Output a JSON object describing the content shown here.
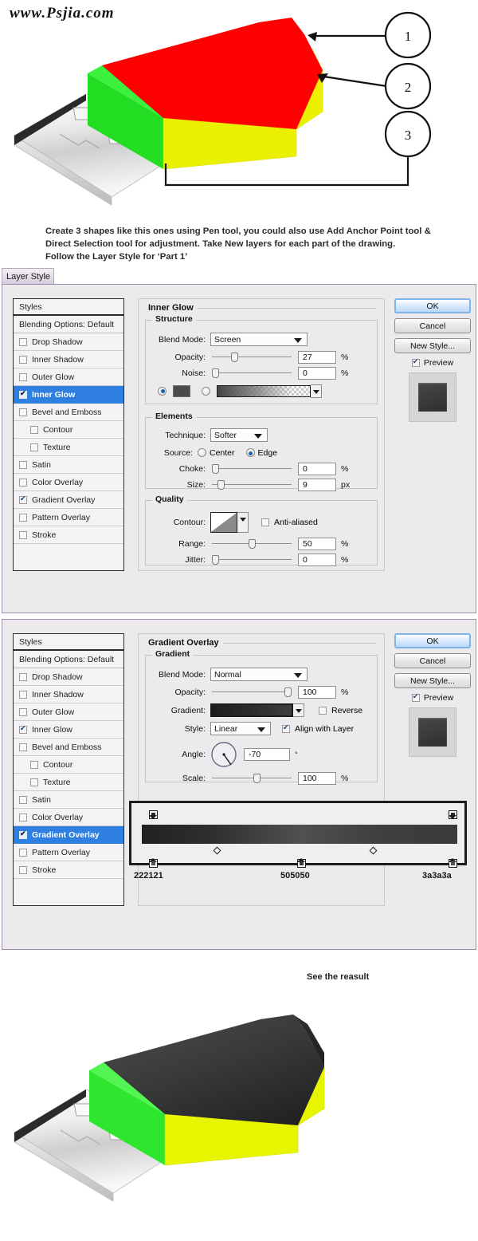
{
  "watermark": "www.Psjia.com",
  "figure_callout": {
    "name": "usb-flash-drive-wireframe",
    "callouts": [
      {
        "number": "1",
        "target": "top-face-red"
      },
      {
        "number": "2",
        "target": "side-face-yellow"
      },
      {
        "number": "3",
        "target": "edge-face-green"
      }
    ],
    "colors": {
      "part1_top": "#ff0000",
      "part2_side": "#eaf000",
      "part3_edge": "#22dd22",
      "connector_metal": "#d8d8d8"
    }
  },
  "instructions": {
    "line1": "Create 3 shapes like this ones using Pen tool, you could also use Add Anchor Point tool &",
    "line2": "Direct Selection tool for adjustment. Take New layers for each part of the drawing.",
    "line3": "Follow the Layer Style for ‘Part 1’"
  },
  "window": {
    "title": "Layer Style"
  },
  "styles_list": {
    "header": "Styles",
    "blending_options": "Blending Options: Default",
    "items": [
      {
        "label": "Drop Shadow",
        "checked": false,
        "sub": false
      },
      {
        "label": "Inner Shadow",
        "checked": false,
        "sub": false
      },
      {
        "label": "Outer Glow",
        "checked": false,
        "sub": false
      },
      {
        "label": "Inner Glow",
        "checked": true,
        "sub": false
      },
      {
        "label": "Bevel and Emboss",
        "checked": false,
        "sub": false
      },
      {
        "label": "Contour",
        "checked": false,
        "sub": true
      },
      {
        "label": "Texture",
        "checked": false,
        "sub": true
      },
      {
        "label": "Satin",
        "checked": false,
        "sub": false
      },
      {
        "label": "Color Overlay",
        "checked": false,
        "sub": false
      },
      {
        "label": "Gradient Overlay",
        "checked": true,
        "sub": false
      },
      {
        "label": "Pattern Overlay",
        "checked": false,
        "sub": false
      },
      {
        "label": "Stroke",
        "checked": false,
        "sub": false
      }
    ]
  },
  "actions": {
    "ok": "OK",
    "cancel": "Cancel",
    "new_style": "New Style...",
    "preview": "Preview",
    "preview_checked": true,
    "accent": "#7fb4e8"
  },
  "dialog_inner_glow": {
    "selected_style": "Inner Glow",
    "panel_title": "Inner Glow",
    "structure": {
      "group_title": "Structure",
      "blend_mode_label": "Blend Mode:",
      "blend_mode_value": "Screen",
      "opacity_label": "Opacity:",
      "opacity_value": "27",
      "opacity_unit": "%",
      "noise_label": "Noise:",
      "noise_value": "0",
      "noise_unit": "%",
      "fill_type": "color",
      "color_swatch": "#4a4a4a"
    },
    "elements": {
      "group_title": "Elements",
      "technique_label": "Technique:",
      "technique_value": "Softer",
      "source_label": "Source:",
      "source_center": "Center",
      "source_edge": "Edge",
      "source_selected": "Edge",
      "choke_label": "Choke:",
      "choke_value": "0",
      "choke_unit": "%",
      "size_label": "Size:",
      "size_value": "9",
      "size_unit": "px"
    },
    "quality": {
      "group_title": "Quality",
      "contour_label": "Contour:",
      "anti_aliased_label": "Anti-aliased",
      "anti_aliased_checked": false,
      "range_label": "Range:",
      "range_value": "50",
      "range_unit": "%",
      "jitter_label": "Jitter:",
      "jitter_value": "0",
      "jitter_unit": "%"
    }
  },
  "dialog_gradient_overlay": {
    "selected_style": "Gradient Overlay",
    "panel_title": "Gradient Overlay",
    "gradient": {
      "group_title": "Gradient",
      "blend_mode_label": "Blend Mode:",
      "blend_mode_value": "Normal",
      "opacity_label": "Opacity:",
      "opacity_value": "100",
      "opacity_unit": "%",
      "gradient_label": "Gradient:",
      "reverse_label": "Reverse",
      "reverse_checked": false,
      "style_label": "Style:",
      "style_value": "Linear",
      "align_with_layer_label": "Align with Layer",
      "align_with_layer_checked": true,
      "angle_label": "Angle:",
      "angle_value": "-70",
      "angle_unit": "°",
      "scale_label": "Scale:",
      "scale_value": "100",
      "scale_unit": "%"
    },
    "gradient_editor": {
      "stops": [
        {
          "hex": "222121",
          "position": 0
        },
        {
          "hex": "505050",
          "position": 50
        },
        {
          "hex": "3a3a3a",
          "position": 100
        }
      ],
      "midpoints": [
        25,
        75
      ]
    }
  },
  "result": {
    "caption": "See the reasult",
    "figure_name": "usb-flash-drive-final",
    "colors": {
      "body_top": "#333333",
      "side": "#e8f500",
      "edge": "#2ee62e",
      "connector_metal": "#dcdcdc"
    }
  }
}
